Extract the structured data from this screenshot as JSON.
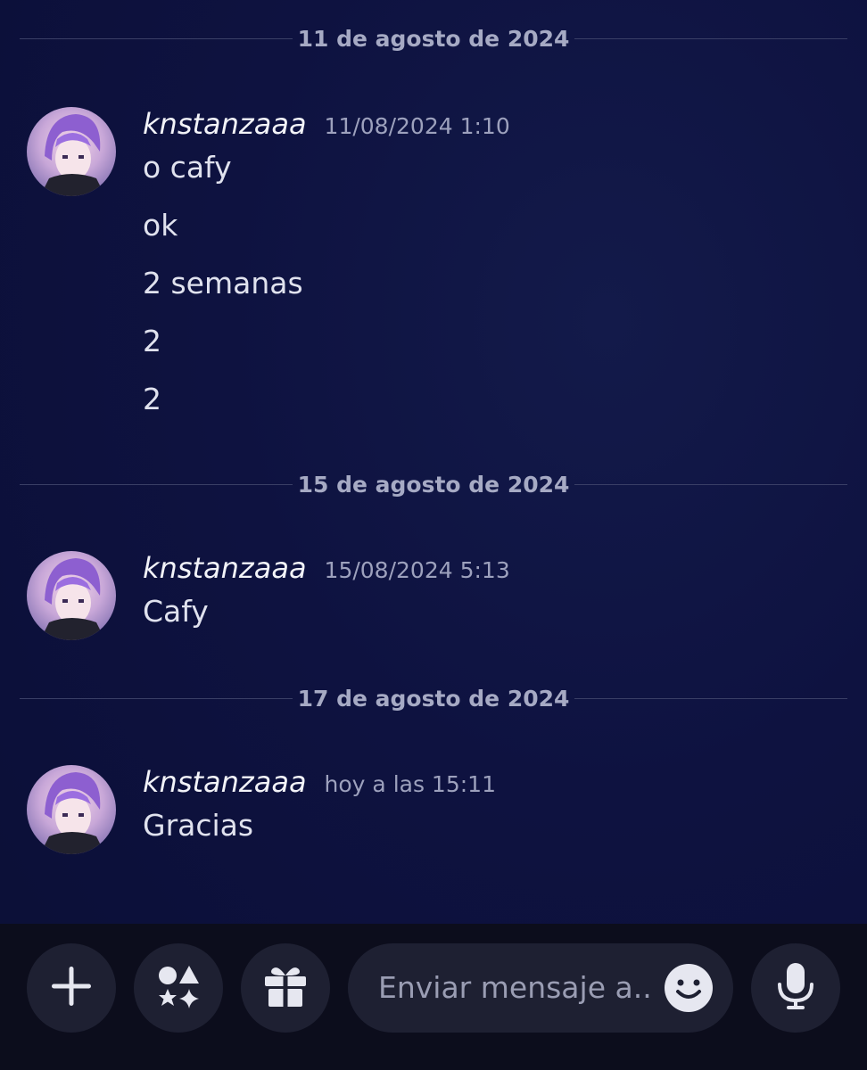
{
  "chat": {
    "dividers": [
      "11 de agosto de 2024",
      "15 de agosto de 2024",
      "17 de agosto de 2024"
    ],
    "messages": [
      {
        "username": "knstanzaaa",
        "timestamp": "11/08/2024 1:10",
        "lines": [
          "o cafy",
          "ok",
          "2 semanas",
          "2",
          "2"
        ]
      },
      {
        "username": "knstanzaaa",
        "timestamp": "15/08/2024 5:13",
        "lines": [
          "Cafy"
        ]
      },
      {
        "username": "knstanzaaa",
        "timestamp": "hoy a las 15:11",
        "lines": [
          "Gracias"
        ]
      }
    ]
  },
  "composer": {
    "placeholder": "Enviar mensaje a..",
    "icons": [
      "plus-icon",
      "apps-icon",
      "gift-icon",
      "emoji-icon",
      "microphone-icon"
    ]
  },
  "colors": {
    "background": "#0e1240",
    "bar": "#0c0d1c",
    "button": "#1e2032",
    "muted_text": "#a6aac4"
  }
}
